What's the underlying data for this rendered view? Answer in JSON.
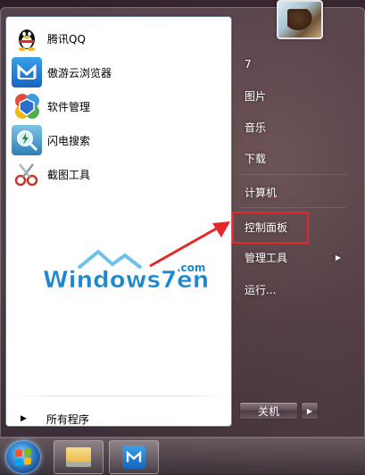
{
  "user": {
    "avatar_icon": "eagle-avatar-icon"
  },
  "programs": [
    {
      "label": "腾讯QQ",
      "icon": "qq-penguin-icon",
      "color": "#ffffff"
    },
    {
      "label": "傲游云浏览器",
      "icon": "maxthon-icon",
      "color": "#1a73c9"
    },
    {
      "label": "软件管理",
      "icon": "software-manager-icon",
      "color": "#2a9c3d"
    },
    {
      "label": "闪电搜索",
      "icon": "lightning-search-icon",
      "color": "#3a8cc4"
    },
    {
      "label": "截图工具",
      "icon": "snipping-tool-icon",
      "color": "#c04a4a"
    }
  ],
  "all_programs_label": "所有程序",
  "right_items": [
    {
      "label": "7"
    },
    {
      "label": "图片"
    },
    {
      "label": "音乐"
    },
    {
      "label": "下载"
    },
    {
      "label": "计算机"
    },
    {
      "label": "控制面板"
    },
    {
      "label": "管理工具"
    },
    {
      "label": "运行..."
    }
  ],
  "shutdown_label": "关机",
  "watermark": {
    "text": "Windows7en",
    "suffix": ".com"
  },
  "highlight_color": "#e4282b"
}
